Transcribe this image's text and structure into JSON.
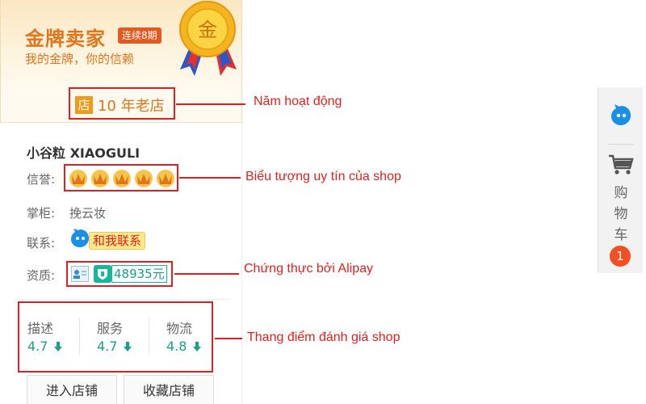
{
  "gold_seller": {
    "title": "金牌卖家",
    "streak_badge": "连续8期",
    "slogan": "我的金牌，你的信赖",
    "medal_text": "金"
  },
  "shop": {
    "store_icon_text": "店",
    "years_text": "10 年老店",
    "name": "小谷粒 XIAOGULI",
    "reputation_label": "信誉:",
    "reputation_crowns": 5,
    "owner_label": "掌柜:",
    "owner_value": "挽云妆",
    "contact_label": "联系:",
    "contact_button": "和我联系",
    "qualification_label": "资质:",
    "deposit": "48935元"
  },
  "scores": [
    {
      "label": "描述",
      "value": "4.7",
      "trend": "down"
    },
    {
      "label": "服务",
      "value": "4.7",
      "trend": "down"
    },
    {
      "label": "物流",
      "value": "4.8",
      "trend": "down"
    }
  ],
  "buttons": {
    "enter_shop": "进入店铺",
    "favorite_shop": "收藏店铺"
  },
  "annotations": {
    "years": "Năm hoạt động",
    "reputation": "Biểu tượng uy tín của shop",
    "alipay": "Chứng thực bởi Alipay",
    "scores": "Thang điểm đánh giá shop"
  },
  "toolbar": {
    "cart_label_1": "购",
    "cart_label_2": "物",
    "cart_label_3": "车",
    "cart_count": "1"
  },
  "colors": {
    "annotation_red": "#e02020",
    "gold": "#e0751c",
    "score_green": "#19a085",
    "cart_badge": "#f25022"
  }
}
